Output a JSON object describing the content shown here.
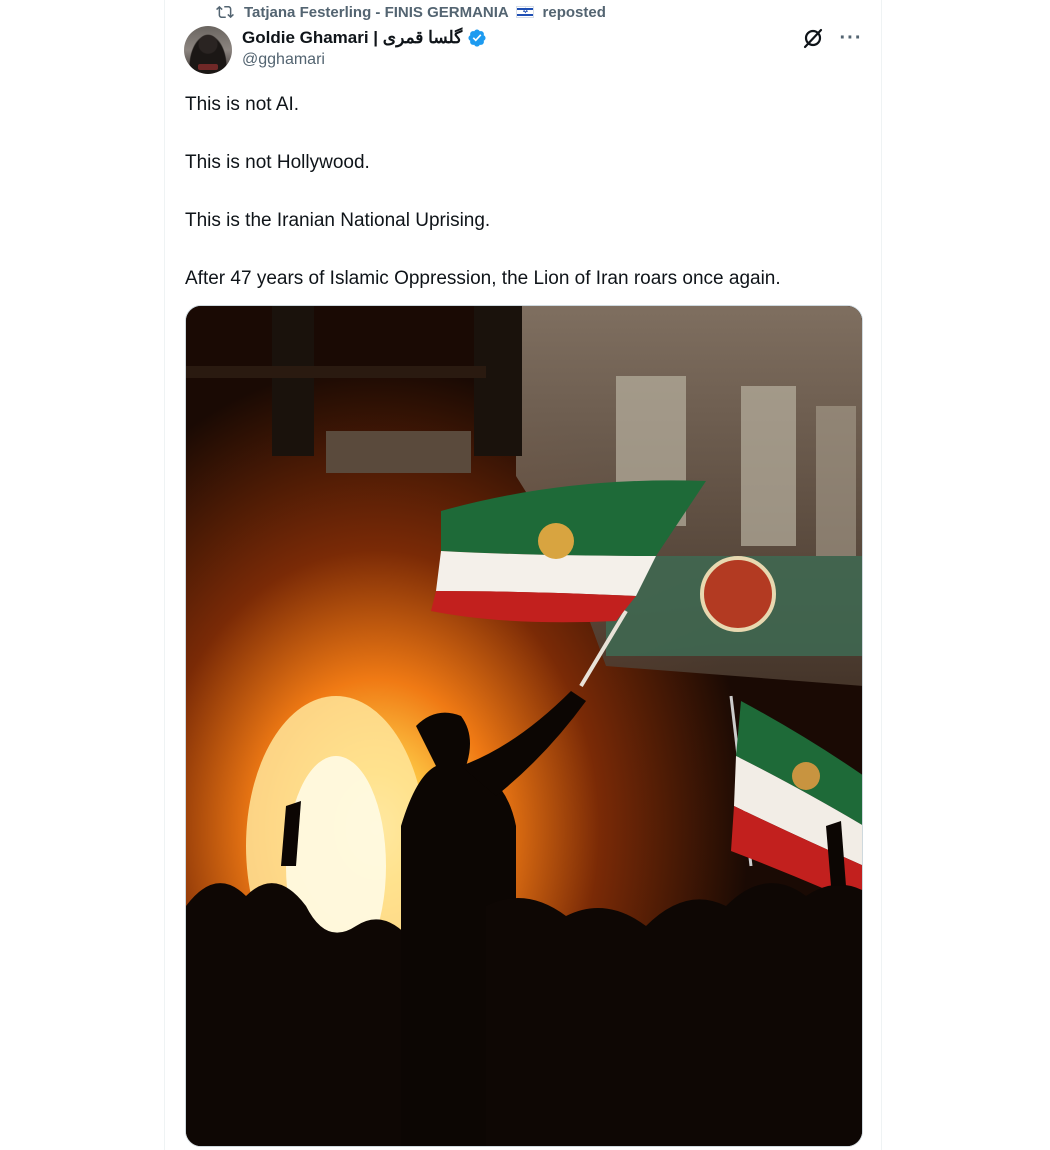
{
  "repost": {
    "name": "Tatjana Festerling - FINIS GERMANIA",
    "suffix": "reposted"
  },
  "author": {
    "display_name": "Goldie Ghamari | گلسا قمری",
    "handle": "@gghamari",
    "verified_color": "#1d9bf0"
  },
  "tweet": {
    "lines": [
      "This is not AI.",
      "This is not Hollywood.",
      "This is the Iranian National Uprising.",
      "After 47 years of Islamic Oppression, the Lion of Iran roars once again."
    ]
  },
  "icons": {
    "repost": "repost-icon",
    "flag": "israel-flag-icon",
    "verified": "verified-badge-icon",
    "grok": "grok-icon",
    "more": "more-icon"
  },
  "colors": {
    "text_primary": "#0f1419",
    "text_secondary": "#536471",
    "border": "#eff3f4"
  }
}
